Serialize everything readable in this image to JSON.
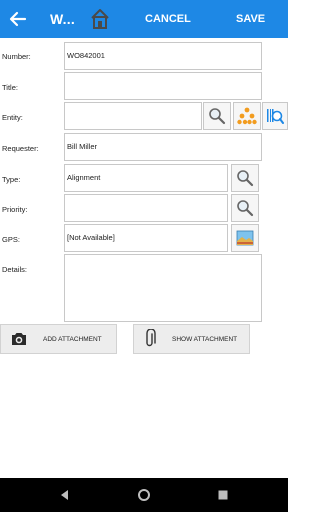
{
  "appbar": {
    "title": "W...",
    "cancel_label": "CANCEL",
    "save_label": "SAVE",
    "accent_color": "#1e88e5"
  },
  "form": {
    "number_label": "Number:",
    "number_value": "WO842001",
    "title_label": "Title:",
    "title_value": "",
    "entity_label": "Entity:",
    "entity_value": "",
    "requester_label": "Requester:",
    "requester_value": "Bill Miller",
    "type_label": "Type:",
    "type_value": "Alignment",
    "priority_label": "Priority:",
    "priority_value": "",
    "gps_label": "GPS:",
    "gps_value": "[Not Available]",
    "details_label": "Details:",
    "details_value": ""
  },
  "attachments": {
    "add_label": "ADD ATTACHMENT",
    "show_label": "SHOW ATTACHMENT"
  },
  "icons": [
    "back-arrow-icon",
    "home-icon",
    "search-icon",
    "hierarchy-icon",
    "barcode-search-icon",
    "map-icon",
    "camera-icon",
    "paperclip-icon",
    "nav-back-icon",
    "nav-home-icon",
    "nav-recents-icon"
  ]
}
